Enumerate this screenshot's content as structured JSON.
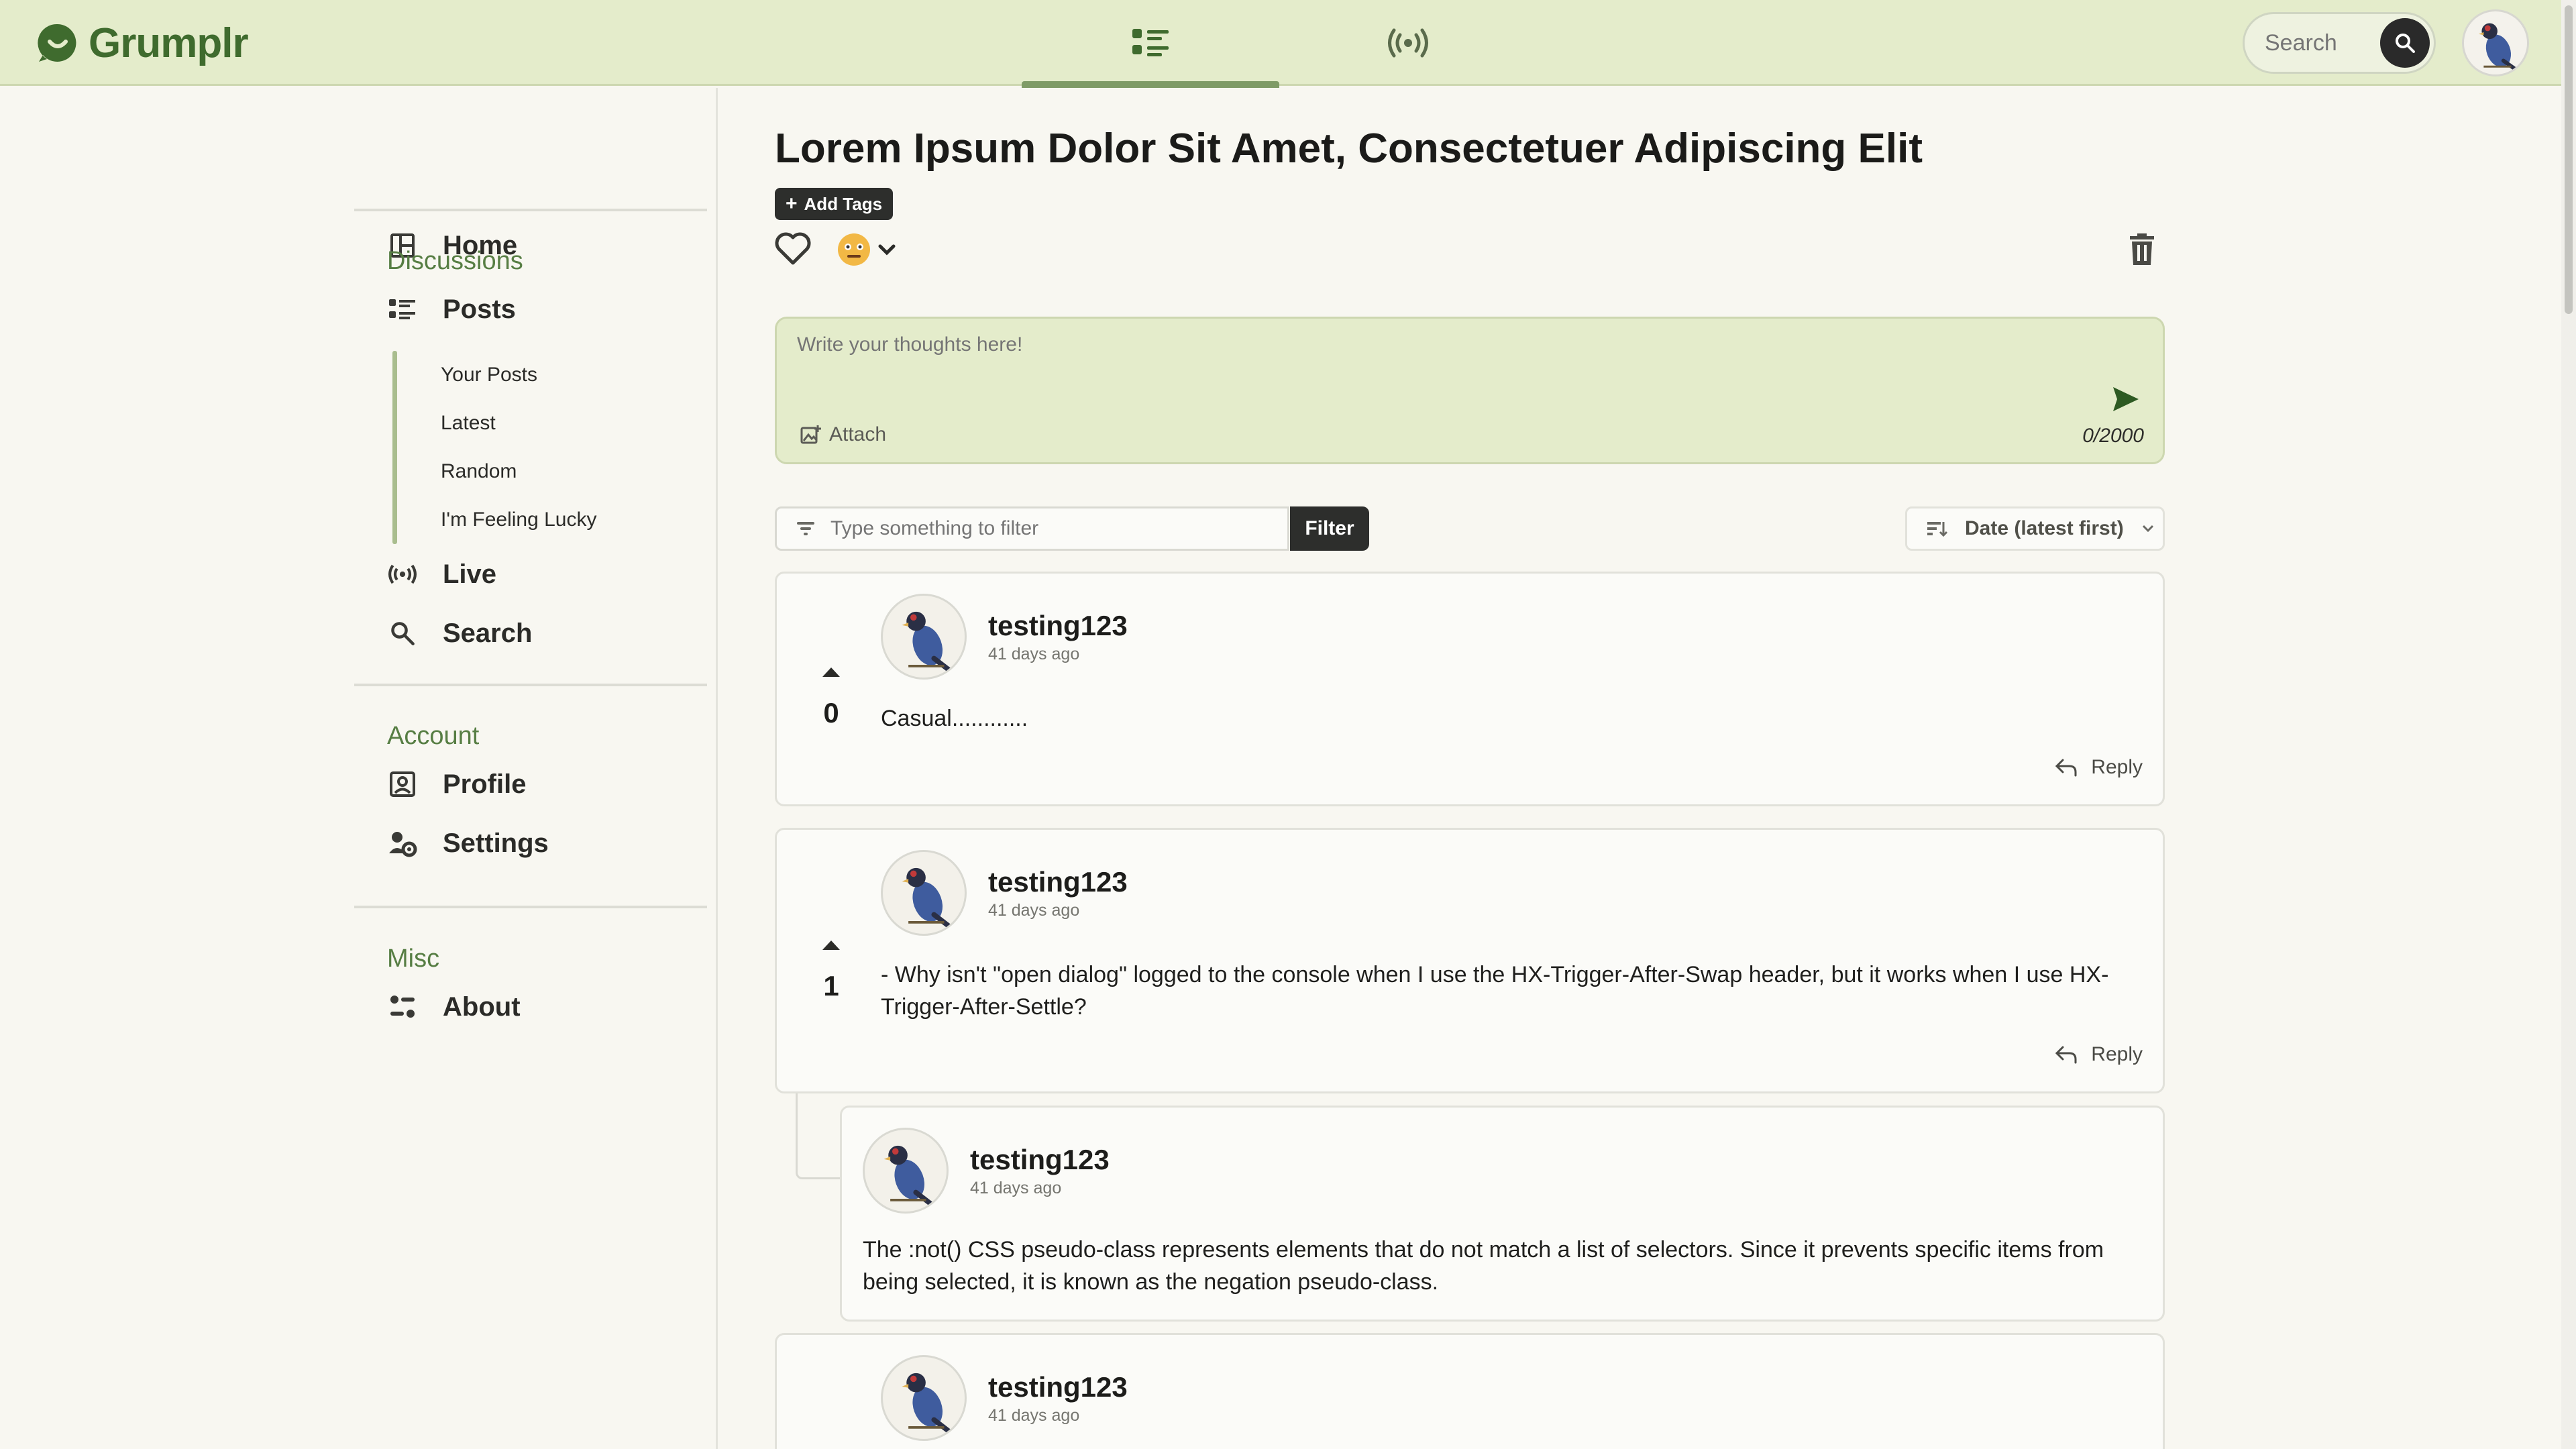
{
  "app": {
    "name": "Grumplr"
  },
  "header": {
    "search_placeholder": "Search"
  },
  "sidebar": {
    "home": "Home",
    "discussions_heading": "Discussions",
    "posts": "Posts",
    "posts_sub": [
      "Your Posts",
      "Latest",
      "Random",
      "I'm Feeling Lucky"
    ],
    "live": "Live",
    "search": "Search",
    "account_heading": "Account",
    "profile": "Profile",
    "settings": "Settings",
    "misc_heading": "Misc",
    "about": "About"
  },
  "post": {
    "title": "Lorem Ipsum Dolor Sit Amet, Consectetuer Adipiscing Elit",
    "add_tags_label": "Add Tags"
  },
  "composer": {
    "placeholder": "Write your thoughts here!",
    "attach_label": "Attach",
    "counter": "0/2000"
  },
  "filter": {
    "placeholder": "Type something to filter",
    "button_label": "Filter",
    "sort_label": "Date (latest first)"
  },
  "comments": [
    {
      "author": "testing123",
      "time": "41 days ago",
      "votes": "0",
      "text": "Casual............",
      "reply_label": "Reply"
    },
    {
      "author": "testing123",
      "time": "41 days ago",
      "votes": "1",
      "text": "- Why isn't \"open dialog\" logged to the console when I use the HX-Trigger-After-Swap header, but it works when I use HX-Trigger-After-Settle?",
      "reply_label": "Reply"
    },
    {
      "author": "testing123",
      "time": "41 days ago",
      "text": "The :not() CSS pseudo-class represents elements that do not match a list of selectors. Since it prevents specific items from being selected, it is known as the negation pseudo-class."
    },
    {
      "author": "testing123",
      "time": "41 days ago"
    }
  ],
  "colors": {
    "brand": "#3f6b2e",
    "header_bg": "#e4eccb",
    "accent": "#7f9b67",
    "page_bg": "#f8f7f1"
  },
  "icons": [
    "grumplr-logo-icon",
    "posts-list-icon",
    "live-broadcast-icon",
    "search-icon",
    "user-avatar",
    "home-icon",
    "live-icon",
    "profile-icon",
    "settings-icon",
    "about-icon",
    "heart-icon",
    "mood-emoji-icon",
    "chevron-down-icon",
    "trash-icon",
    "send-icon",
    "attach-image-icon",
    "filter-icon",
    "sort-icon",
    "upvote-icon",
    "reply-icon"
  ]
}
